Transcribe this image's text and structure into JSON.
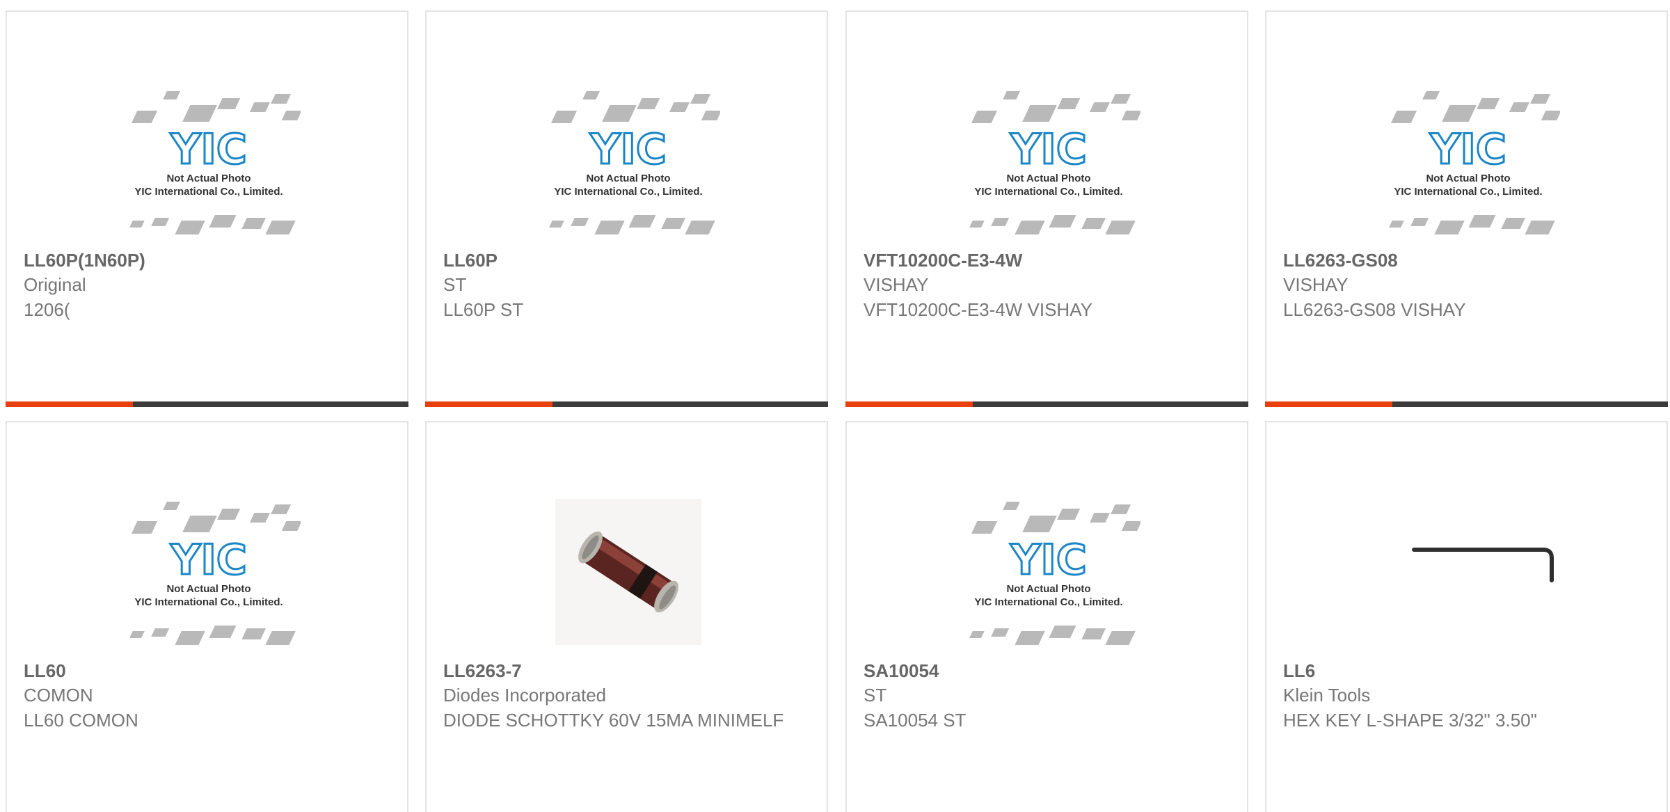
{
  "placeholder": {
    "logo_text": "YIC",
    "caption_line1": "Not Actual Photo",
    "caption_line2": "YIC International Co., Limited."
  },
  "colors": {
    "accent": "#e8400c",
    "bar": "#3b3b3b",
    "logo": "#1a86c8",
    "chip": "#b9b9b9"
  },
  "products": [
    {
      "part": "LL60P(1N60P)",
      "maker": "Original",
      "desc": "1206(",
      "image": "placeholder"
    },
    {
      "part": "LL60P",
      "maker": "ST",
      "desc": "LL60P ST",
      "image": "placeholder"
    },
    {
      "part": "VFT10200C-E3-4W",
      "maker": "VISHAY",
      "desc": "VFT10200C-E3-4W VISHAY",
      "image": "placeholder"
    },
    {
      "part": "LL6263-GS08",
      "maker": "VISHAY",
      "desc": "LL6263-GS08 VISHAY",
      "image": "placeholder"
    },
    {
      "part": "LL60",
      "maker": "COMON",
      "desc": "LL60 COMON",
      "image": "placeholder"
    },
    {
      "part": "LL6263-7",
      "maker": "Diodes Incorporated",
      "desc": "DIODE SCHOTTKY 60V 15MA MINIMELF",
      "image": "diode-photo"
    },
    {
      "part": "SA10054",
      "maker": "ST",
      "desc": "SA10054 ST",
      "image": "placeholder"
    },
    {
      "part": "LL6",
      "maker": "Klein Tools",
      "desc": "HEX KEY L-SHAPE 3/32\" 3.50\"",
      "image": "hex-key-photo"
    }
  ]
}
